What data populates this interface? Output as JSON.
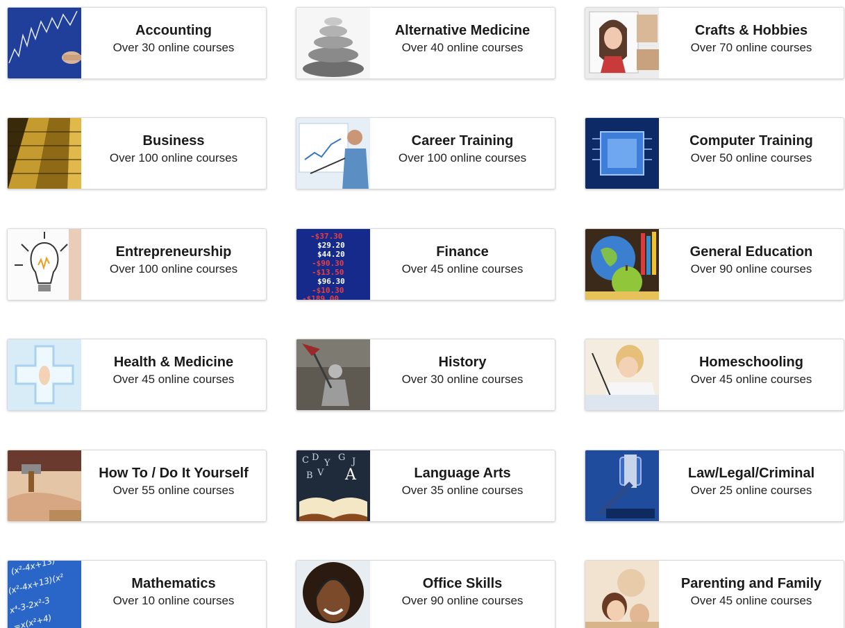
{
  "categories": [
    {
      "title": "Accounting",
      "subtitle": "Over 30 online courses",
      "icon": "stock-chart-icon"
    },
    {
      "title": "Alternative Medicine",
      "subtitle": "Over 40 online courses",
      "icon": "stacked-stones-icon"
    },
    {
      "title": "Crafts & Hobbies",
      "subtitle": "Over 70 online courses",
      "icon": "painting-icon"
    },
    {
      "title": "Business",
      "subtitle": "Over 100 online courses",
      "icon": "skyscraper-icon"
    },
    {
      "title": "Career Training",
      "subtitle": "Over 100 online courses",
      "icon": "presenter-icon"
    },
    {
      "title": "Computer Training",
      "subtitle": "Over 50 online courses",
      "icon": "microchip-icon"
    },
    {
      "title": "Entrepreneurship",
      "subtitle": "Over 100 online courses",
      "icon": "lightbulb-icon"
    },
    {
      "title": "Finance",
      "subtitle": "Over 45 online courses",
      "icon": "stock-ticker-icon"
    },
    {
      "title": "General Education",
      "subtitle": "Over 90 online courses",
      "icon": "globe-apple-icon"
    },
    {
      "title": "Health & Medicine",
      "subtitle": "Over 45 online courses",
      "icon": "medical-cross-icon"
    },
    {
      "title": "History",
      "subtitle": "Over 30 online courses",
      "icon": "knight-icon"
    },
    {
      "title": "Homeschooling",
      "subtitle": "Over 45 online courses",
      "icon": "child-writing-icon"
    },
    {
      "title": "How To / Do It Yourself",
      "subtitle": "Over 55 online courses",
      "icon": "hammer-icon"
    },
    {
      "title": "Language Arts",
      "subtitle": "Over 35 online courses",
      "icon": "open-book-icon"
    },
    {
      "title": "Law/Legal/Criminal",
      "subtitle": "Over 25 online courses",
      "icon": "gavel-icon"
    },
    {
      "title": "Mathematics",
      "subtitle": "Over 10 online courses",
      "icon": "chalkboard-equations-icon"
    },
    {
      "title": "Office Skills",
      "subtitle": "Over 90 online courses",
      "icon": "headset-woman-icon"
    },
    {
      "title": "Parenting and Family",
      "subtitle": "Over 45 online courses",
      "icon": "family-icon"
    }
  ],
  "colors": {
    "text": "#1a1a1a",
    "card_border": "#d9d9d9",
    "background": "#ffffff"
  }
}
